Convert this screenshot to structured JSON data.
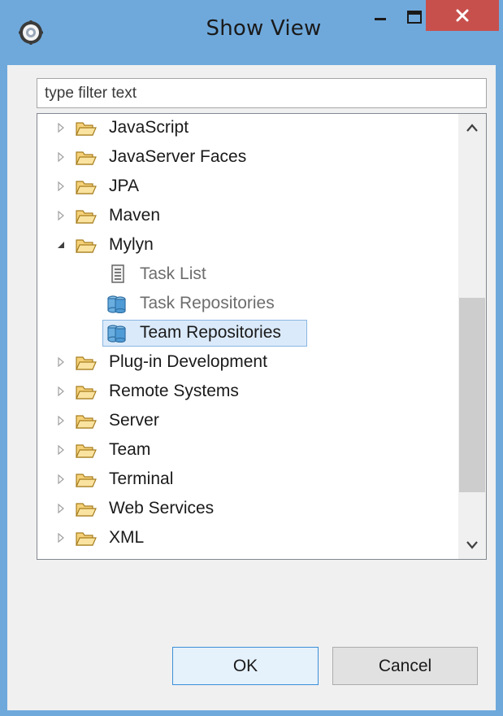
{
  "window": {
    "title": "Show View",
    "title_bar_color": "#6fa9dc",
    "close_color": "#c7504d",
    "icons": {
      "app": "eclipse-icon",
      "minimize": "minimize-icon",
      "maximize": "maximize-icon",
      "close": "close-icon"
    }
  },
  "filter": {
    "value": "type filter text",
    "placeholder": "type filter text"
  },
  "tree": {
    "items": [
      {
        "label": "JavaScript",
        "type": "folder",
        "state": "collapsed"
      },
      {
        "label": "JavaServer Faces",
        "type": "folder",
        "state": "collapsed"
      },
      {
        "label": "JPA",
        "type": "folder",
        "state": "collapsed"
      },
      {
        "label": "Maven",
        "type": "folder",
        "state": "collapsed"
      },
      {
        "label": "Mylyn",
        "type": "folder",
        "state": "expanded"
      },
      {
        "label": "Task List",
        "type": "view",
        "icon": "task-list-icon"
      },
      {
        "label": "Task Repositories",
        "type": "view",
        "icon": "repository-icon"
      },
      {
        "label": "Team Repositories",
        "type": "view",
        "icon": "repository-icon",
        "selected": true
      },
      {
        "label": "Plug-in Development",
        "type": "folder",
        "state": "collapsed"
      },
      {
        "label": "Remote Systems",
        "type": "folder",
        "state": "collapsed"
      },
      {
        "label": "Server",
        "type": "folder",
        "state": "collapsed"
      },
      {
        "label": "Team",
        "type": "folder",
        "state": "collapsed"
      },
      {
        "label": "Terminal",
        "type": "folder",
        "state": "collapsed"
      },
      {
        "label": "Web Services",
        "type": "folder",
        "state": "collapsed"
      },
      {
        "label": "XML",
        "type": "folder",
        "state": "collapsed"
      }
    ],
    "scroll": {
      "thumb_start": 0.4,
      "thumb_end": 0.9
    }
  },
  "buttons": {
    "ok": "OK",
    "cancel": "Cancel"
  },
  "colors": {
    "selection_bg": "#dbeafa",
    "selection_border": "#8ab7e3",
    "folder": "#e8b84a"
  }
}
